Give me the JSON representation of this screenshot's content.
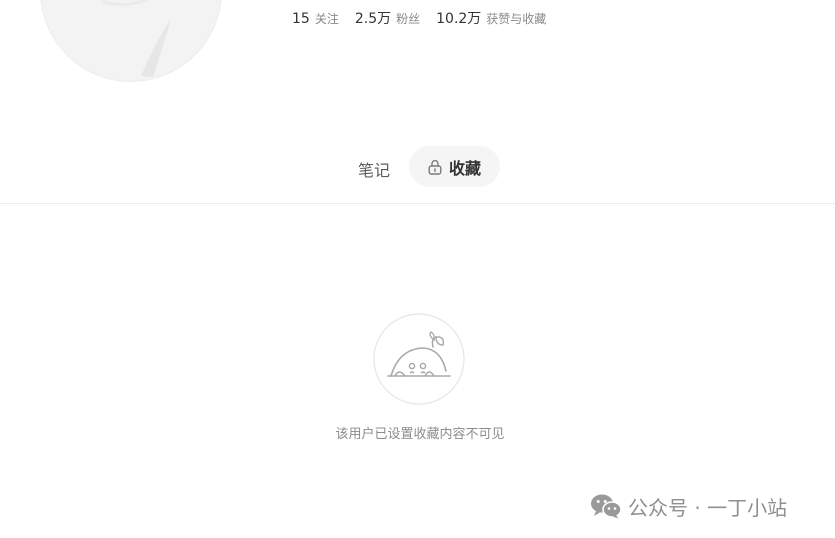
{
  "profile": {
    "stats": [
      {
        "value": "15",
        "label": "关注"
      },
      {
        "value": "2.5万",
        "label": "粉丝"
      },
      {
        "value": "10.2万",
        "label": "获赞与收藏"
      }
    ]
  },
  "tabs": [
    {
      "label": "笔记",
      "selected": false
    },
    {
      "label": "收藏",
      "selected": true,
      "icon": "lock-icon"
    }
  ],
  "empty_state": {
    "icon": "empty-creature-icon",
    "message": "该用户已设置收藏内容不可见"
  },
  "watermark": {
    "icon": "wechat-icon",
    "text": "公众号 · 一丁小站"
  }
}
